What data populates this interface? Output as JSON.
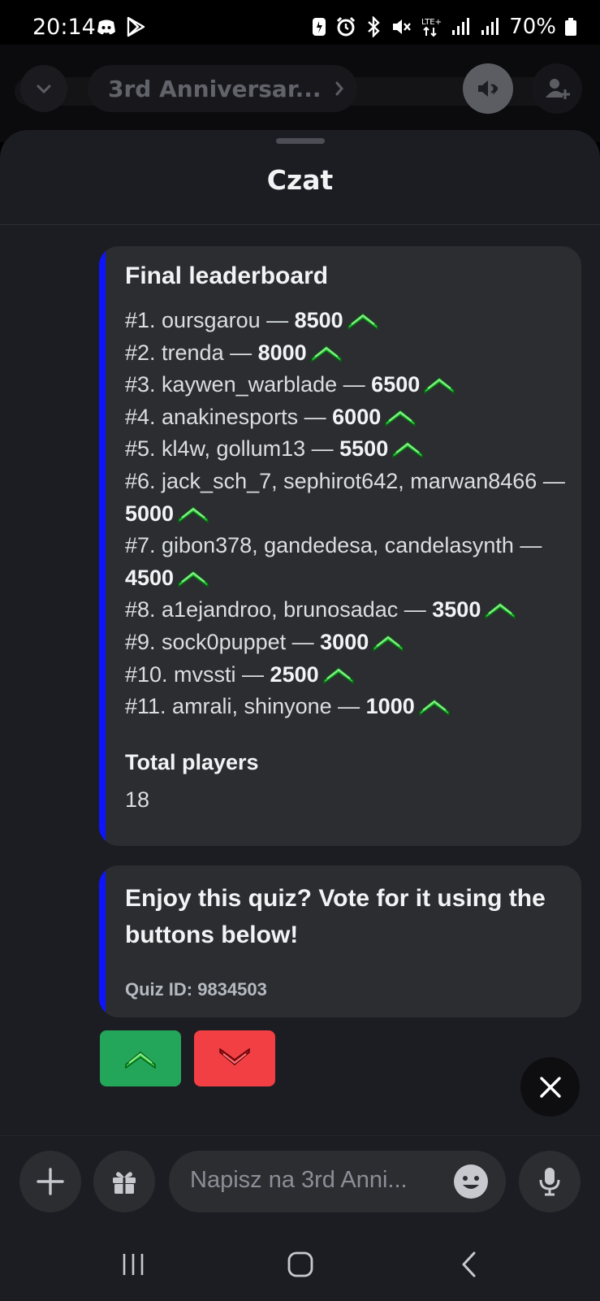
{
  "status_bar": {
    "time": "20:14",
    "battery": "70%",
    "icons": [
      "discord-icon",
      "play-store-icon",
      "notification-icon",
      "alarm-icon",
      "bluetooth-icon",
      "mute-icon",
      "lte-icon",
      "signal-icon",
      "signal-icon",
      "battery-icon"
    ]
  },
  "background_header": {
    "channel_name": "3rd Anniversar..."
  },
  "sheet": {
    "title": "Czat"
  },
  "leaderboard_embed": {
    "title": "Final leaderboard",
    "entries": [
      {
        "text": "#1. oursgarou — ",
        "score": "8500"
      },
      {
        "text": "#2. trenda — ",
        "score": "8000"
      },
      {
        "text": "#3. kaywen_warblade — ",
        "score": "6500"
      },
      {
        "text": "#4. anakinesports — ",
        "score": "6000"
      },
      {
        "text": "#5. kl4w, gollum13 — ",
        "score": "5500"
      },
      {
        "text": "#6. jack_sch_7, sephirot642, marwan8466 — ",
        "score": "5000"
      },
      {
        "text": "#7. gibon378, gandedesa, candelasynth — ",
        "score": "4500"
      },
      {
        "text": "#8. a1ejandroo, brunosadac — ",
        "score": "3500"
      },
      {
        "text": "#9. sock0puppet — ",
        "score": "3000"
      },
      {
        "text": "#10. mvssti — ",
        "score": "2500"
      },
      {
        "text": "#11. amrali, shinyone — ",
        "score": "1000"
      }
    ],
    "field_name": "Total players",
    "field_value": "18"
  },
  "vote_embed": {
    "text": "Enjoy this quiz? Vote for it using the buttons below!",
    "quiz_id": "Quiz ID: 9834503"
  },
  "colors": {
    "embed_accent": "#0d14ff",
    "upvote": "#23a55a",
    "downvote": "#f23f43",
    "up_chevron": "#3ddc3d"
  },
  "composer": {
    "placeholder": "Napisz na 3rd Anni..."
  }
}
